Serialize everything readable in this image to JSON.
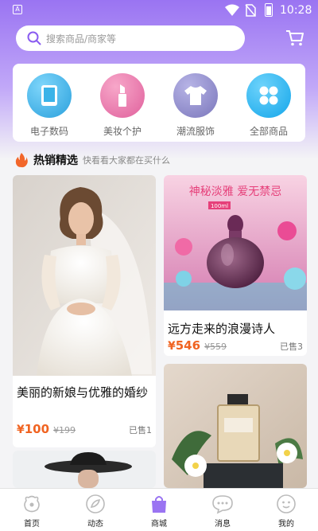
{
  "status": {
    "time": "10:28",
    "a_badge": "A"
  },
  "search": {
    "placeholder": "搜索商品/商家等"
  },
  "categories": [
    {
      "label": "电子数码",
      "icon": "tablet-icon",
      "color": "#3ab3e8"
    },
    {
      "label": "美妆个护",
      "icon": "lipstick-icon",
      "color": "#e66aa6"
    },
    {
      "label": "潮流服饰",
      "icon": "tshirt-icon",
      "color": "#8a86c6"
    },
    {
      "label": "全部商品",
      "icon": "grid-icon",
      "color": "#1fb2ef"
    }
  ],
  "section": {
    "title": "热销精选",
    "subtitle": "快看看大家都在买什么"
  },
  "products": [
    {
      "name": "美丽的新娘与优雅的婚纱",
      "currency": "¥",
      "price": "100",
      "old_price": "¥199",
      "sold": "已售1"
    },
    {
      "name": "远方走来的浪漫诗人",
      "currency": "¥",
      "price": "546",
      "old_price": "¥559",
      "sold": "已售3"
    }
  ],
  "promo": {
    "line1": "神秘淡雅 爱无禁忌",
    "tag": "100ml"
  },
  "tabs": [
    {
      "label": "首页",
      "icon": "home-icon"
    },
    {
      "label": "动态",
      "icon": "feed-icon"
    },
    {
      "label": "商城",
      "icon": "shop-bag-icon",
      "active": true
    },
    {
      "label": "消息",
      "icon": "message-icon"
    },
    {
      "label": "我的",
      "icon": "profile-icon"
    }
  ],
  "colors": {
    "accent": "#9a74f2",
    "price": "#f06422"
  }
}
